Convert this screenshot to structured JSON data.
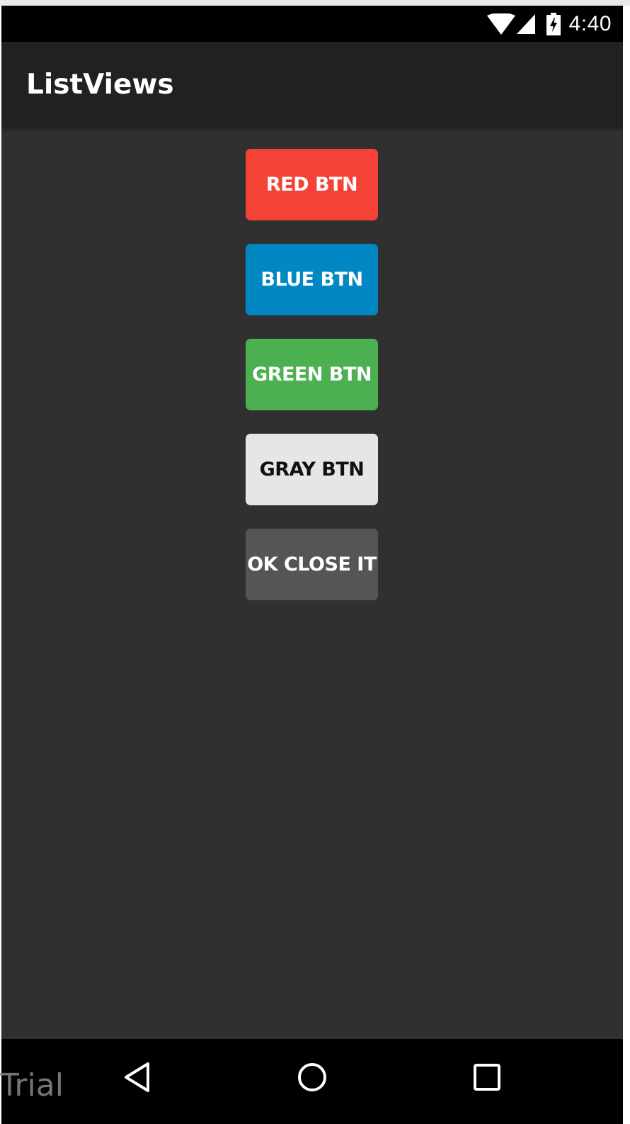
{
  "status_bar": {
    "time": "4:40",
    "icons": [
      "wifi-icon",
      "signal-icon",
      "battery-charging-icon"
    ]
  },
  "action_bar": {
    "title": "ListViews"
  },
  "buttons": [
    {
      "label": "RED BTN",
      "color": "#f44336",
      "text_color": "#ffffff"
    },
    {
      "label": "BLUE BTN",
      "color": "#0188c2",
      "text_color": "#ffffff"
    },
    {
      "label": "GREEN BTN",
      "color": "#4caf50",
      "text_color": "#ffffff"
    },
    {
      "label": "GRAY BTN",
      "color": "#e6e6e6",
      "text_color": "#111111"
    },
    {
      "label": "OK CLOSE IT",
      "color": "#555555",
      "text_color": "#ffffff"
    }
  ],
  "nav_bar": {
    "icons": [
      "back-icon",
      "home-icon",
      "recent-apps-icon"
    ]
  },
  "watermark": "Trial",
  "colors": {
    "background": "#303030",
    "action_bar": "#212121",
    "status_bar": "#000000"
  }
}
